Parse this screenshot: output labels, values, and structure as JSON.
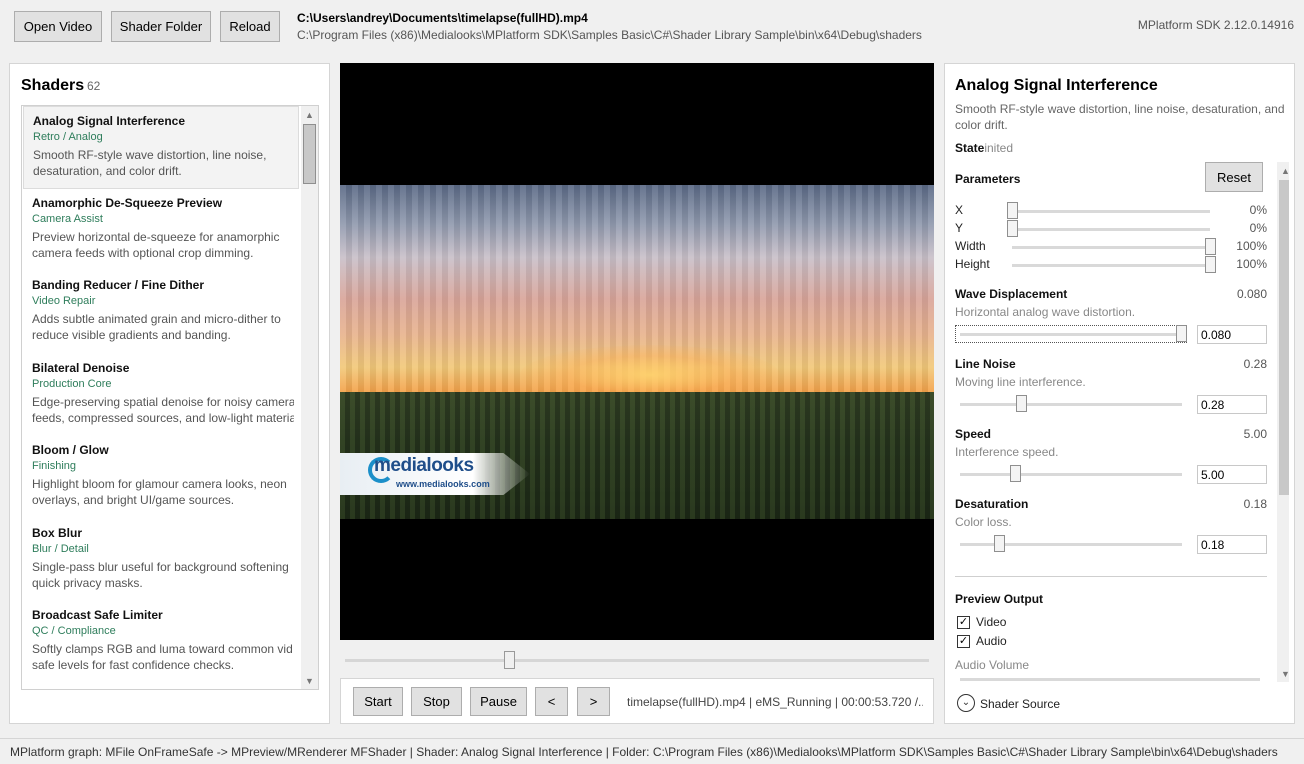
{
  "toolbar": {
    "open_video": "Open Video",
    "shader_folder": "Shader Folder",
    "reload": "Reload",
    "video_path": "C:\\Users\\andrey\\Documents\\timelapse(fullHD).mp4",
    "shader_path": "C:\\Program Files (x86)\\Medialooks\\MPlatform SDK\\Samples Basic\\C#\\Shader Library Sample\\bin\\x64\\Debug\\shaders",
    "sdk_version": "MPlatform SDK 2.12.0.14916"
  },
  "shaders": {
    "title": "Shaders",
    "count": "62",
    "items": [
      {
        "title": "Analog Signal Interference",
        "category": "Retro / Analog",
        "desc1": "Smooth RF-style wave distortion, line noise,",
        "desc2": "desaturation, and color drift."
      },
      {
        "title": "Anamorphic De-Squeeze Preview",
        "category": "Camera Assist",
        "desc1": "Preview horizontal de-squeeze for anamorphic",
        "desc2": "camera feeds with optional crop dimming."
      },
      {
        "title": "Banding Reducer / Fine Dither",
        "category": "Video Repair",
        "desc1": "Adds subtle animated grain and micro-dither to",
        "desc2": "reduce visible gradients and banding."
      },
      {
        "title": "Bilateral Denoise",
        "category": "Production Core",
        "desc1": "Edge-preserving spatial denoise for noisy camera",
        "desc2": "feeds, compressed sources, and low-light materia"
      },
      {
        "title": "Bloom / Glow",
        "category": "Finishing",
        "desc1": "Highlight bloom for glamour camera looks, neon",
        "desc2": "overlays, and bright UI/game sources."
      },
      {
        "title": "Box Blur",
        "category": "Blur / Detail",
        "desc1": "Single-pass blur useful for background softening",
        "desc2": "quick privacy masks."
      },
      {
        "title": "Broadcast Safe Limiter",
        "category": "QC / Compliance",
        "desc1": "Softly clamps RGB and luma toward common vid",
        "desc2": "safe levels for fast confidence checks."
      }
    ]
  },
  "video": {
    "logo_text": "medialooks",
    "logo_url": "www.medialooks.com",
    "position_fraction": 0.28
  },
  "transport": {
    "start": "Start",
    "stop": "Stop",
    "pause": "Pause",
    "prev": "<",
    "next": ">",
    "status": "timelapse(fullHD).mp4 | eMS_Running | 00:00:53.720 /..."
  },
  "details": {
    "title": "Analog Signal Interference",
    "desc": "Smooth RF-style wave distortion, line noise, desaturation, and color drift.",
    "state_label": "State",
    "state_value": "inited",
    "parameters_label": "Parameters",
    "reset": "Reset",
    "rect": [
      {
        "label": "X",
        "value": "0%",
        "fraction": 0.0
      },
      {
        "label": "Y",
        "value": "0%",
        "fraction": 0.0
      },
      {
        "label": "Width",
        "value": "100%",
        "fraction": 1.0
      },
      {
        "label": "Height",
        "value": "100%",
        "fraction": 1.0
      }
    ],
    "params": [
      {
        "name": "Wave Displacement",
        "value": "0.080",
        "desc": "Horizontal analog wave distortion.",
        "input": "0.080",
        "fraction": 1.0
      },
      {
        "name": "Line Noise",
        "value": "0.28",
        "desc": "Moving line interference.",
        "input": "0.28",
        "fraction": 0.28
      },
      {
        "name": "Speed",
        "value": "5.00",
        "desc": "Interference speed.",
        "input": "5.00",
        "fraction": 0.25
      },
      {
        "name": "Desaturation",
        "value": "0.18",
        "desc": "Color loss.",
        "input": "0.18",
        "fraction": 0.18
      }
    ],
    "preview_output": "Preview Output",
    "video_label": "Video",
    "audio_label": "Audio",
    "audio_volume": "Audio Volume",
    "shader_source": "Shader Source"
  },
  "statusbar": {
    "text": "MPlatform graph: MFile OnFrameSafe -> MPreview/MRenderer MFShader | Shader: Analog Signal Interference | Folder: C:\\Program Files (x86)\\Medialooks\\MPlatform SDK\\Samples Basic\\C#\\Shader Library Sample\\bin\\x64\\Debug\\shaders"
  }
}
